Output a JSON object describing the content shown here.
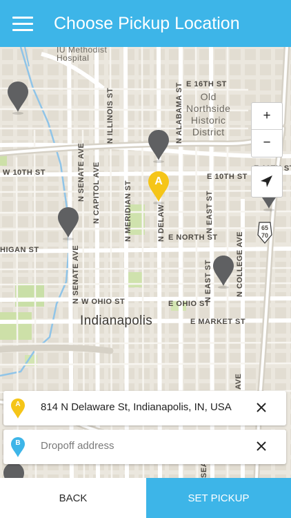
{
  "header": {
    "title": "Choose Pickup Location",
    "menu_icon": "hamburger-menu-icon"
  },
  "map": {
    "labels": {
      "hospital": "IU Methodist\nHospital",
      "e16th": "E 16TH ST",
      "old_northside": "Old\nNorthside\nHistoric\nDistrict",
      "illinois": "N ILLINOIS ST",
      "alabama": "N ALABAMA ST",
      "w10th": "W 10TH ST",
      "e10th_a": "E 10TH ST",
      "e10th_b": "E 10TH ST",
      "senate_a": "N SENATE AVE",
      "capitol": "N CAPITOL AVE",
      "meridian": "N MERIDIAN ST",
      "delaware": "N DELAW",
      "east_a": "N EAST ST",
      "michigan": "HIGAN ST",
      "senate_b": "N SENATE AVE",
      "north_st": "E NORTH ST",
      "east_b": "N EAST ST",
      "college": "N COLLEGE AVE",
      "w_ohio": "W OHIO ST",
      "e_ohio": "E OHIO ST",
      "city": "Indianapolis",
      "market": "E MARKET ST",
      "ave_low": "AVE",
      "sea": "SEA",
      "highway_top": "65",
      "highway_bottom": "70"
    },
    "zoom_in": "+",
    "zoom_out": "−",
    "locate_icon": "navigation-arrow-icon",
    "selected_pin_letter": "A",
    "colors": {
      "pin_gray": "#5f6062",
      "pin_selected": "#f5c518",
      "accent": "#3db5e8"
    }
  },
  "pickup": {
    "marker": "A",
    "address": "814 N Delaware St, Indianapolis, IN, USA"
  },
  "dropoff": {
    "marker": "B",
    "placeholder": "Dropoff address"
  },
  "footer": {
    "back_label": "BACK",
    "set_label": "SET PICKUP"
  }
}
